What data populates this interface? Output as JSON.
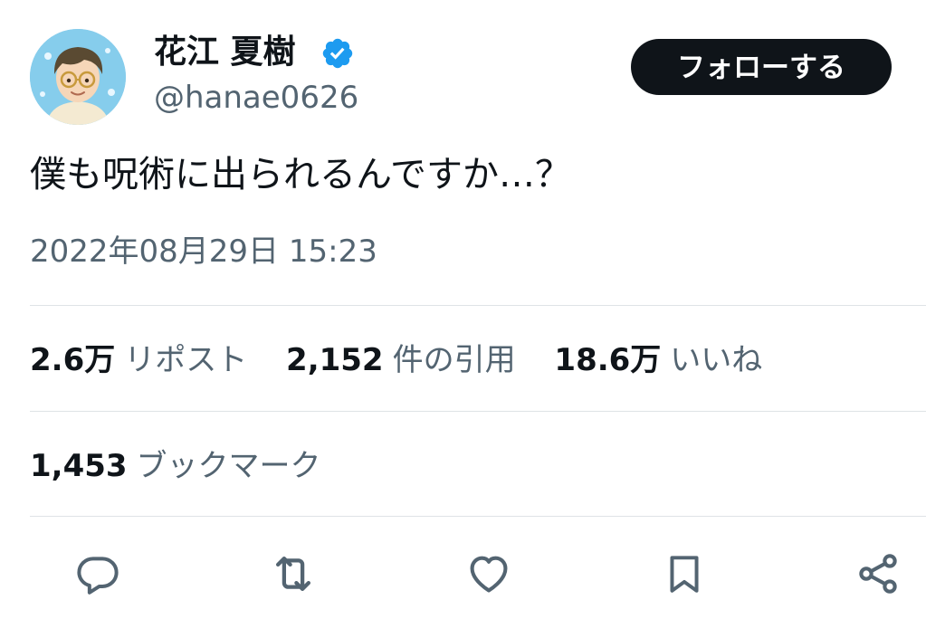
{
  "author": {
    "display_name": "花江 夏樹",
    "handle": "@hanae0626",
    "verified": true
  },
  "follow_button": {
    "label": "フォローする"
  },
  "tweet": {
    "text": "僕も呪術に出られるんですか…？",
    "timestamp": "2022年08月29日 15:23"
  },
  "stats": {
    "reposts": {
      "count": "2.6万",
      "label": "リポスト"
    },
    "quotes": {
      "count": "2,152",
      "label": "件の引用"
    },
    "likes": {
      "count": "18.6万",
      "label": "いいね"
    },
    "bookmarks": {
      "count": "1,453",
      "label": "ブックマーク"
    }
  },
  "actions": [
    {
      "icon": "reply-icon"
    },
    {
      "icon": "repost-icon"
    },
    {
      "icon": "like-icon"
    },
    {
      "icon": "bookmark-icon"
    },
    {
      "icon": "share-icon"
    }
  ],
  "colors": {
    "text_primary": "#0f1419",
    "text_secondary": "#536471",
    "verified_blue": "#1d9bf0",
    "divider": "#dfe3e6",
    "follow_button_bg": "#0f1419"
  }
}
